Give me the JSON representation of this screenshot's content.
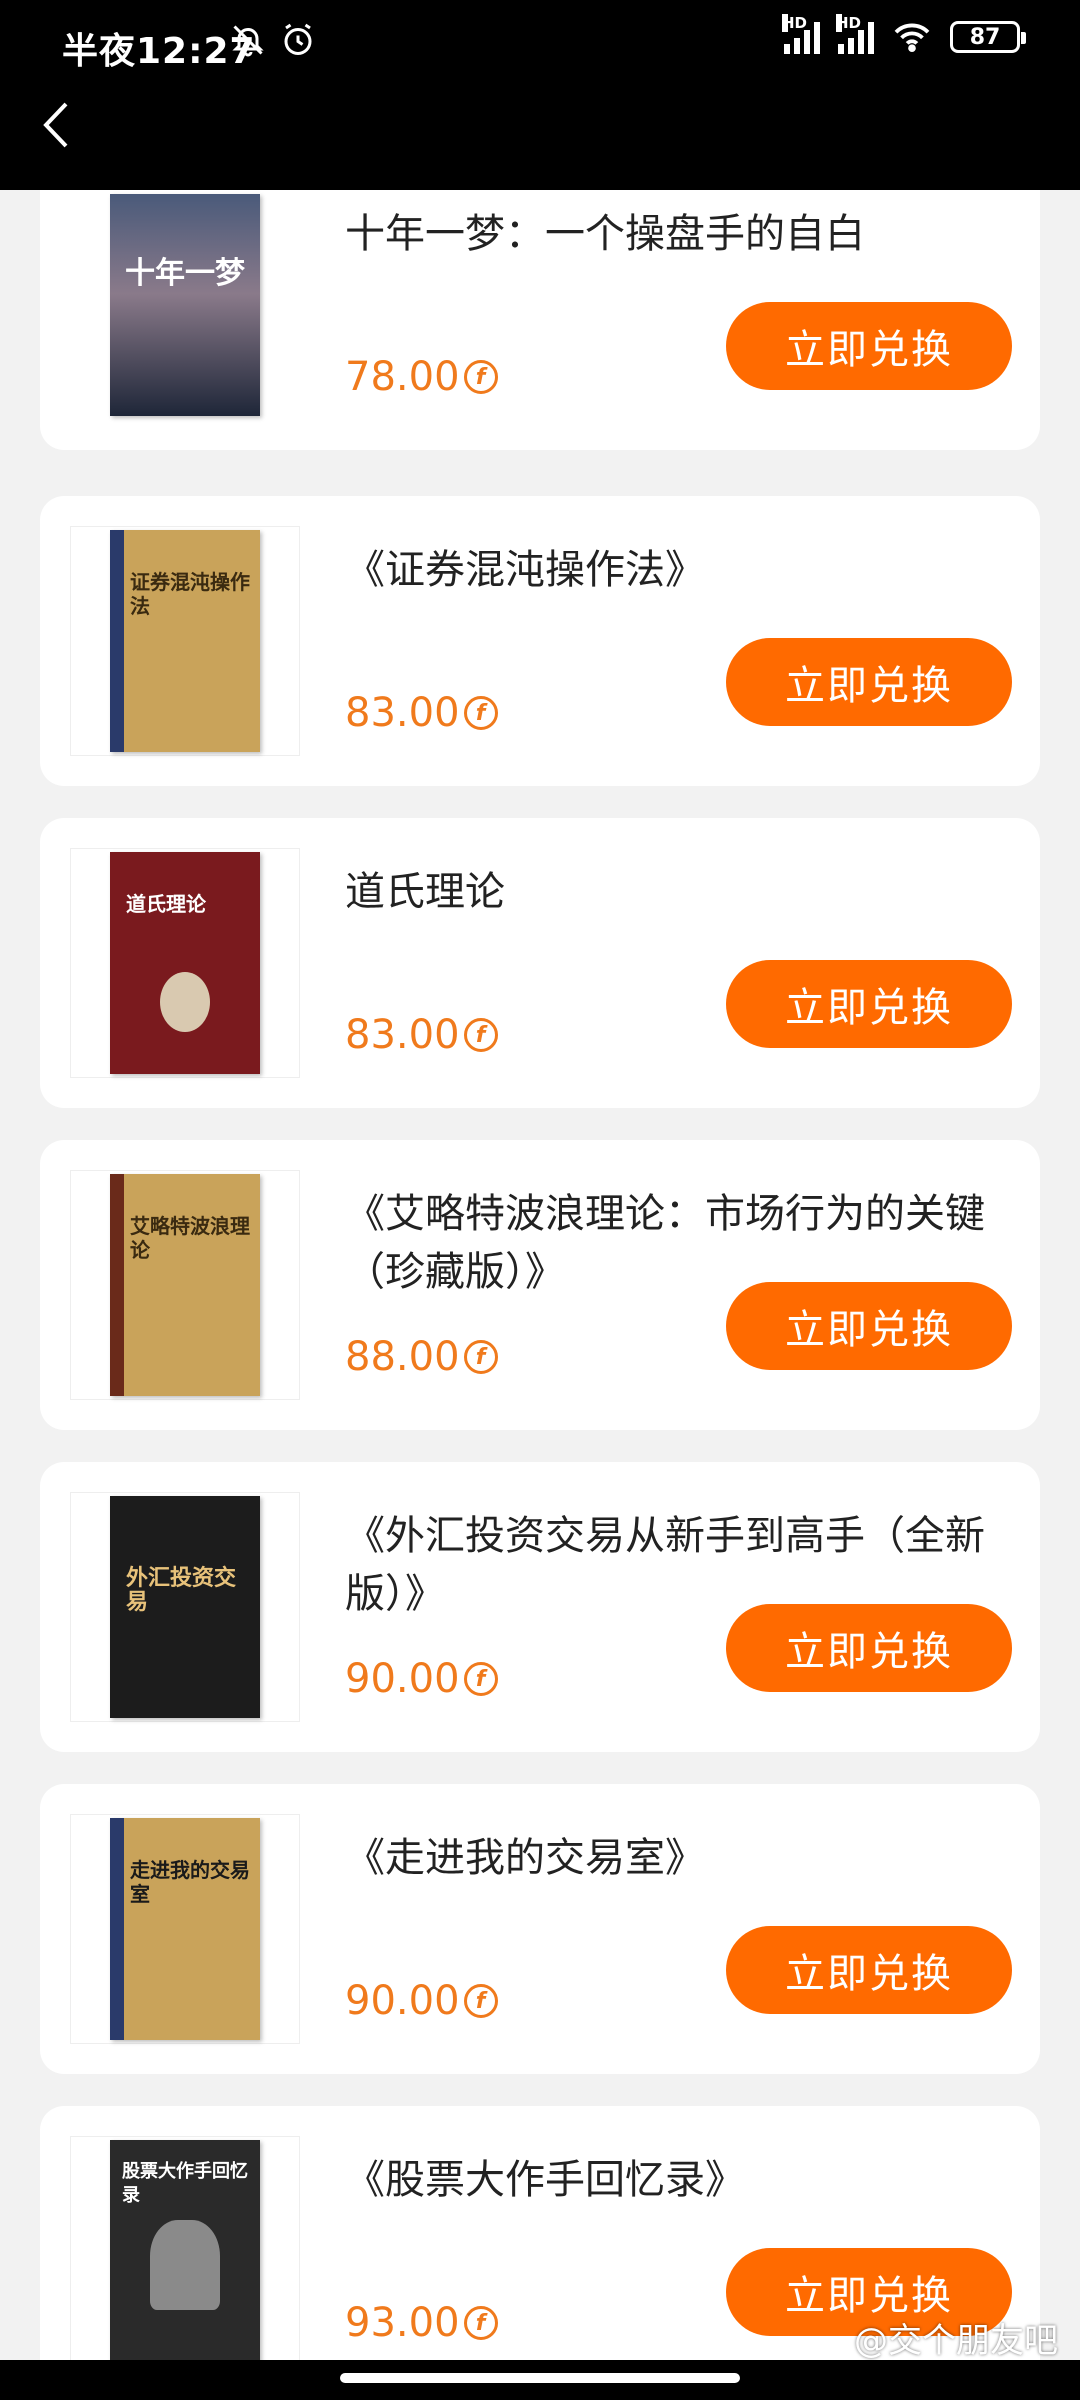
{
  "status_bar": {
    "time": "半夜12:27",
    "battery": "87",
    "signal_label": "HD"
  },
  "header": {
    "back_icon": "chevron-left-icon"
  },
  "items": [
    {
      "title": "十年一梦：一个操盘手的自白",
      "price": "78.00",
      "button": "立即兑换",
      "cover_color": "#2b3a55",
      "cover_text": "十年一梦"
    },
    {
      "title": "《证券混沌操作法》",
      "price": "83.00",
      "button": "立即兑换",
      "cover_color": "#c9a35a",
      "cover_text": "证券混沌操作法"
    },
    {
      "title": "道氏理论",
      "price": "83.00",
      "button": "立即兑换",
      "cover_color": "#7a1a1e",
      "cover_text": "道氏理论"
    },
    {
      "title": "《艾略特波浪理论：市场行为的关键（珍藏版）》",
      "price": "88.00",
      "button": "立即兑换",
      "cover_color": "#c9a35a",
      "cover_text": "艾略特波浪理论"
    },
    {
      "title": "《外汇投资交易从新手到高手（全新版）》",
      "price": "90.00",
      "button": "立即兑换",
      "cover_color": "#1c1c1c",
      "cover_text": "外汇投资交易"
    },
    {
      "title": "《走进我的交易室》",
      "price": "90.00",
      "button": "立即兑换",
      "cover_color": "#c9a35a",
      "cover_text": "走进我的交易室"
    },
    {
      "title": "《股票大作手回忆录》",
      "price": "93.00",
      "button": "立即兑换",
      "cover_color": "#2a2a2a",
      "cover_text": "股票大作手回忆录"
    }
  ],
  "watermark": "@交个朋友吧",
  "colors": {
    "accent": "#ff6a00",
    "price": "#f07a1c"
  }
}
